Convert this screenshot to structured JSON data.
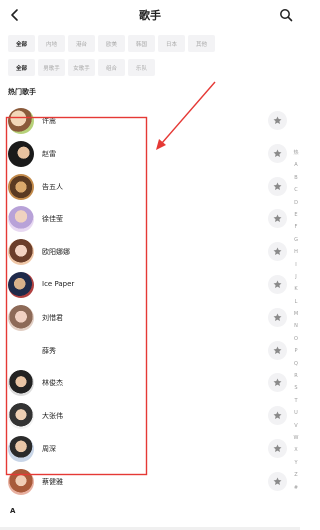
{
  "header": {
    "title": "歌手"
  },
  "filters": {
    "region": [
      {
        "label": "全部",
        "active": true
      },
      {
        "label": "内地",
        "active": false
      },
      {
        "label": "港台",
        "active": false
      },
      {
        "label": "欧美",
        "active": false
      },
      {
        "label": "韩国",
        "active": false
      },
      {
        "label": "日本",
        "active": false
      },
      {
        "label": "其他",
        "active": false
      }
    ],
    "type": [
      {
        "label": "全部",
        "active": true
      },
      {
        "label": "男歌手",
        "active": false
      },
      {
        "label": "女歌手",
        "active": false
      },
      {
        "label": "组合",
        "active": false
      },
      {
        "label": "乐队",
        "active": false
      }
    ]
  },
  "section": {
    "hot_title": "热门歌手",
    "next_letter": "A"
  },
  "artists": [
    {
      "name": "许嵩"
    },
    {
      "name": "赵雷"
    },
    {
      "name": "告五人"
    },
    {
      "name": "徐佳莹"
    },
    {
      "name": "欧阳娜娜"
    },
    {
      "name": "Ice Paper"
    },
    {
      "name": "刘惜君"
    },
    {
      "name": "薛秀"
    },
    {
      "name": "林俊杰"
    },
    {
      "name": "大张伟"
    },
    {
      "name": "周深"
    },
    {
      "name": "蔡健雅"
    }
  ],
  "index_letters": [
    "热",
    "A",
    "B",
    "C",
    "D",
    "E",
    "F",
    "G",
    "H",
    "I",
    "J",
    "K",
    "L",
    "M",
    "N",
    "O",
    "P",
    "Q",
    "R",
    "S",
    "T",
    "U",
    "V",
    "W",
    "X",
    "Y",
    "Z",
    "#"
  ],
  "colors": {
    "annotation": "#e53935",
    "chip_bg": "#f3f3f5",
    "fav_bg": "#f2f2f4"
  },
  "icons": {
    "back": "chevron-left-icon",
    "search": "search-icon",
    "favorite": "star-icon"
  }
}
